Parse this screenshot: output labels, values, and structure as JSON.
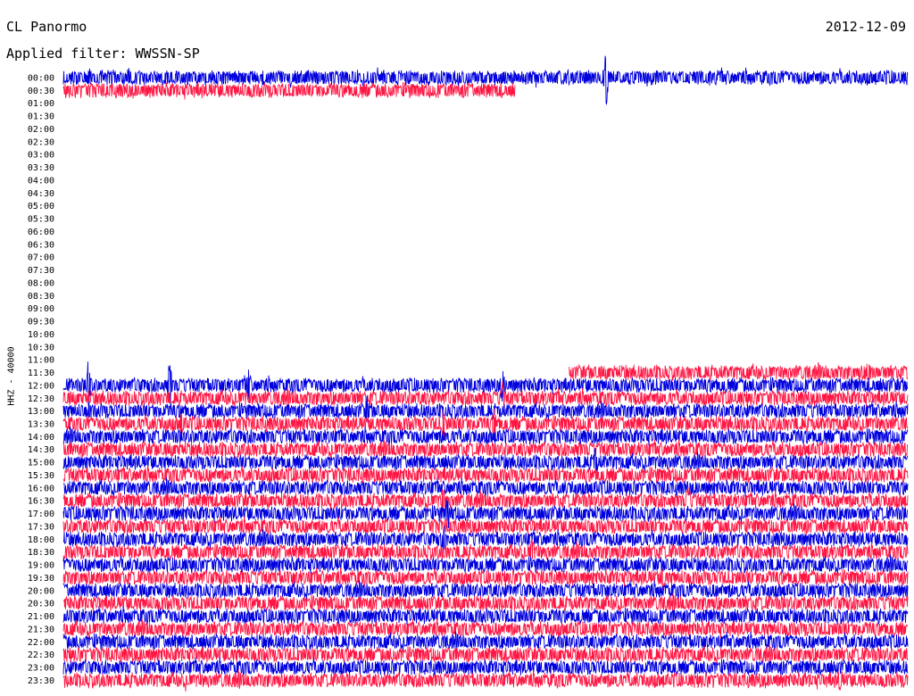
{
  "header": {
    "station": "CL Panormo",
    "date": "2012-12-09",
    "filter": "Applied filter: WWSSN-SP"
  },
  "colors": {
    "trace_a": "#0000dd",
    "trace_b": "#ff1744",
    "background": "#ffffff"
  },
  "chart_data": {
    "type": "line",
    "title": "CL Panormo",
    "subtitle": "Applied filter: WWSSN-SP",
    "ylabel": "HHZ - 40000",
    "xlabel": "",
    "row_interval_minutes": 30,
    "x_unit": "fraction of 30-minute row",
    "tick_labels": [
      "00:00",
      "00:30",
      "01:00",
      "01:30",
      "02:00",
      "02:30",
      "03:00",
      "03:30",
      "04:00",
      "04:30",
      "05:00",
      "05:30",
      "06:00",
      "06:30",
      "07:00",
      "07:30",
      "08:00",
      "08:30",
      "09:00",
      "09:30",
      "10:00",
      "10:30",
      "11:00",
      "11:30",
      "12:00",
      "12:30",
      "13:00",
      "13:30",
      "14:00",
      "14:30",
      "15:00",
      "15:30",
      "16:00",
      "16:30",
      "17:00",
      "17:30",
      "18:00",
      "18:30",
      "19:00",
      "19:30",
      "20:00",
      "20:30",
      "21:00",
      "21:30",
      "22:00",
      "22:30",
      "23:00",
      "23:30"
    ],
    "series": [
      {
        "row": 0,
        "color": "blue",
        "start": 0.0,
        "end": 1.0,
        "events": [
          [
            0.643,
            1.0
          ]
        ]
      },
      {
        "row": 1,
        "color": "red",
        "start": 0.0,
        "end": 0.535,
        "events": []
      },
      {
        "row": 23,
        "color": "red",
        "start": 0.599,
        "end": 1.0,
        "events": [
          [
            0.953,
            0.35
          ]
        ]
      },
      {
        "row": 24,
        "color": "blue",
        "start": 0.0,
        "end": 1.0,
        "events": [
          [
            0.03,
            1.0
          ],
          [
            0.126,
            0.8
          ],
          [
            0.219,
            0.6
          ],
          [
            0.52,
            0.5
          ]
        ]
      },
      {
        "row": 25,
        "color": "red",
        "start": 0.0,
        "end": 1.0,
        "events": [
          [
            0.52,
            0.4
          ]
        ]
      },
      {
        "row": 26,
        "color": "blue",
        "start": 0.0,
        "end": 1.0,
        "events": [
          [
            0.36,
            0.4
          ]
        ]
      },
      {
        "row": 27,
        "color": "red",
        "start": 0.0,
        "end": 1.0,
        "events": [
          [
            0.14,
            0.3
          ],
          [
            0.45,
            0.5
          ],
          [
            0.51,
            0.4
          ]
        ]
      },
      {
        "row": 28,
        "color": "blue",
        "start": 0.0,
        "end": 1.0,
        "events": []
      },
      {
        "row": 29,
        "color": "red",
        "start": 0.0,
        "end": 1.0,
        "events": []
      },
      {
        "row": 30,
        "color": "blue",
        "start": 0.0,
        "end": 1.0,
        "events": [
          [
            0.63,
            0.4
          ]
        ]
      },
      {
        "row": 31,
        "color": "red",
        "start": 0.0,
        "end": 1.0,
        "events": []
      },
      {
        "row": 32,
        "color": "blue",
        "start": 0.0,
        "end": 1.0,
        "events": []
      },
      {
        "row": 33,
        "color": "red",
        "start": 0.0,
        "end": 1.0,
        "events": [
          [
            0.45,
            0.35
          ],
          [
            0.74,
            0.35
          ]
        ]
      },
      {
        "row": 34,
        "color": "blue",
        "start": 0.0,
        "end": 1.0,
        "events": [
          [
            0.455,
            0.5
          ]
        ]
      },
      {
        "row": 35,
        "color": "red",
        "start": 0.0,
        "end": 1.0,
        "events": []
      },
      {
        "row": 36,
        "color": "blue",
        "start": 0.0,
        "end": 1.0,
        "events": [
          [
            0.45,
            0.3
          ]
        ]
      },
      {
        "row": 37,
        "color": "red",
        "start": 0.0,
        "end": 1.0,
        "events": [
          [
            0.555,
            0.4
          ]
        ]
      },
      {
        "row": 38,
        "color": "blue",
        "start": 0.0,
        "end": 1.0,
        "events": []
      },
      {
        "row": 39,
        "color": "red",
        "start": 0.0,
        "end": 1.0,
        "events": [
          [
            0.71,
            0.3
          ]
        ]
      },
      {
        "row": 40,
        "color": "blue",
        "start": 0.0,
        "end": 1.0,
        "events": []
      },
      {
        "row": 41,
        "color": "red",
        "start": 0.0,
        "end": 1.0,
        "events": []
      },
      {
        "row": 42,
        "color": "blue",
        "start": 0.0,
        "end": 1.0,
        "events": []
      },
      {
        "row": 43,
        "color": "red",
        "start": 0.0,
        "end": 1.0,
        "events": []
      },
      {
        "row": 44,
        "color": "blue",
        "start": 0.0,
        "end": 1.0,
        "events": []
      },
      {
        "row": 45,
        "color": "red",
        "start": 0.0,
        "end": 1.0,
        "events": []
      },
      {
        "row": 46,
        "color": "blue",
        "start": 0.0,
        "end": 1.0,
        "events": []
      },
      {
        "row": 47,
        "color": "red",
        "start": 0.0,
        "end": 1.0,
        "events": [
          [
            0.92,
            0.3
          ]
        ]
      }
    ]
  }
}
